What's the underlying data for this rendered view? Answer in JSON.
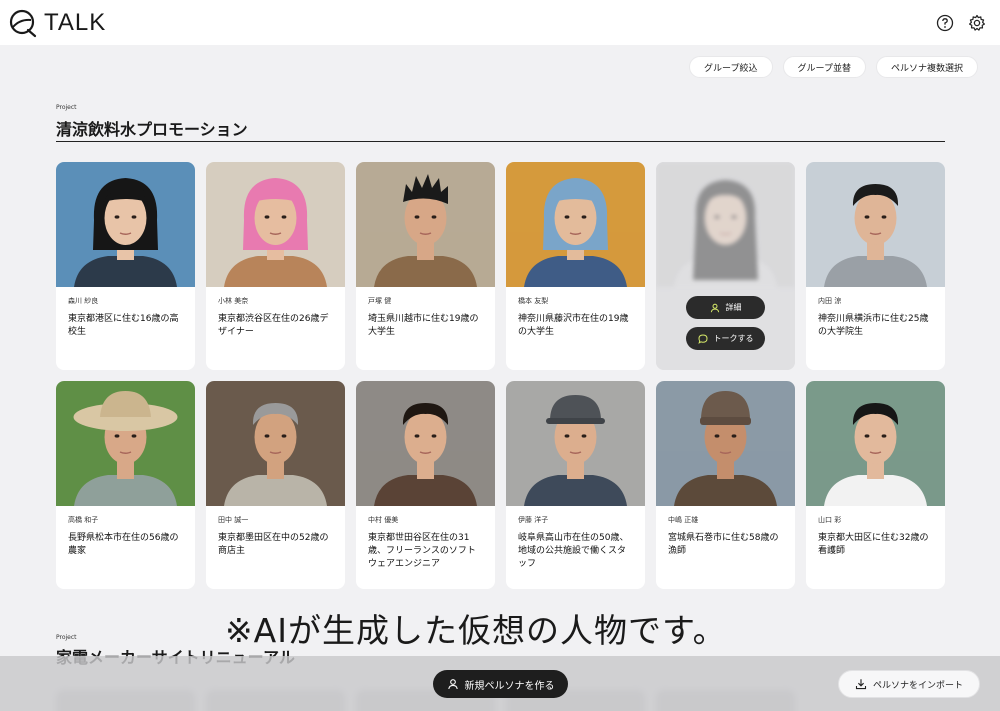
{
  "app": {
    "logo_text": "TALK"
  },
  "top_icons": [
    "help-icon",
    "gear-icon"
  ],
  "group_actions": [
    "グループ絞込",
    "グループ並替",
    "ペルソナ複数選択"
  ],
  "project": {
    "label": "Project",
    "title": "清涼飲料水プロモーション"
  },
  "personas": [
    {
      "name": "森川 紗良",
      "desc": "東京都港区に住む16歳の高校生",
      "bg": "#5b8fb8",
      "hair": "#161616",
      "skin": "#e8c4a8",
      "cloth": "#2c3a4a",
      "hair_style": "bob"
    },
    {
      "name": "小林 美奈",
      "desc": "東京都渋谷区在住の26歳デザイナー",
      "bg": "#d6cdbf",
      "hair": "#e87ab0",
      "skin": "#e6bda0",
      "cloth": "#b8845a",
      "hair_style": "bob"
    },
    {
      "name": "戸塚 健",
      "desc": "埼玉県川越市に住む19歳の大学生",
      "bg": "#b7aa95",
      "hair": "#1a1a1a",
      "skin": "#d7a787",
      "cloth": "#8a6a4a",
      "hair_style": "spiky"
    },
    {
      "name": "橋本 友梨",
      "desc": "神奈川県藤沢市在住の19歳の大学生",
      "bg": "#d59a3c",
      "hair": "#7aa5c9",
      "skin": "#e3bb9b",
      "cloth": "#3f5c86",
      "hair_style": "bob"
    },
    {
      "name": "",
      "desc": "",
      "bg": "#c9c9cb",
      "hair": "#2a2a2a",
      "skin": "#dcc0ac",
      "cloth": "#d8d8da",
      "hair_style": "long"
    },
    {
      "name": "内田 涼",
      "desc": "神奈川県横浜市に住む25歳の大学院生",
      "bg": "#c7cfd6",
      "hair": "#1b1b1b",
      "skin": "#dfb597",
      "cloth": "#9aa0a6",
      "hair_style": "short"
    },
    {
      "name": "高橋 和子",
      "desc": "長野県松本市在住の56歳の農家",
      "bg": "#5f8f46",
      "hair": "#d6c8a8",
      "skin": "#d8a888",
      "cloth": "#8fa09a",
      "hair_style": "hat"
    },
    {
      "name": "田中 誠一",
      "desc": "東京都墨田区在中の52歳の商店主",
      "bg": "#6a5a4c",
      "hair": "#9a9a9a",
      "skin": "#d2a27f",
      "cloth": "#b9b4a8",
      "hair_style": "short"
    },
    {
      "name": "中村 優美",
      "desc": "東京都世田谷区在住の31歳、フリーランスのソフトウェアエンジニア",
      "bg": "#8e8a86",
      "hair": "#1f1712",
      "skin": "#dcae8e",
      "cloth": "#5a4336",
      "hair_style": "tied"
    },
    {
      "name": "伊藤 洋子",
      "desc": "岐阜県高山市在住の50歳、地域の公共施設で働くスタッフ",
      "bg": "#a8a8a6",
      "hair": "#5b6066",
      "skin": "#dcae8e",
      "cloth": "#3e4a5a",
      "hair_style": "cap"
    },
    {
      "name": "中嶋 正雄",
      "desc": "宮城県石巻市に住む58歳の漁師",
      "bg": "#8b9aa6",
      "hair": "#7a6656",
      "skin": "#c48e6c",
      "cloth": "#5c4a3a",
      "hair_style": "beanie"
    },
    {
      "name": "山口 彩",
      "desc": "東京都大田区に住む32歳の看護師",
      "bg": "#7a9a8a",
      "hair": "#161616",
      "skin": "#e2b99c",
      "cloth": "#f2f2f2",
      "hair_style": "tied"
    }
  ],
  "hover_actions": {
    "detail": "詳細",
    "talk": "トークする"
  },
  "disclaimer": "※AIが生成した仮想の人物です。",
  "project2": {
    "label": "Project",
    "title": "家電メーカーサイトリニューアル"
  },
  "bottom": {
    "create_label": "新規ペルソナを作る",
    "import_label": "ペルソナをインポート"
  }
}
